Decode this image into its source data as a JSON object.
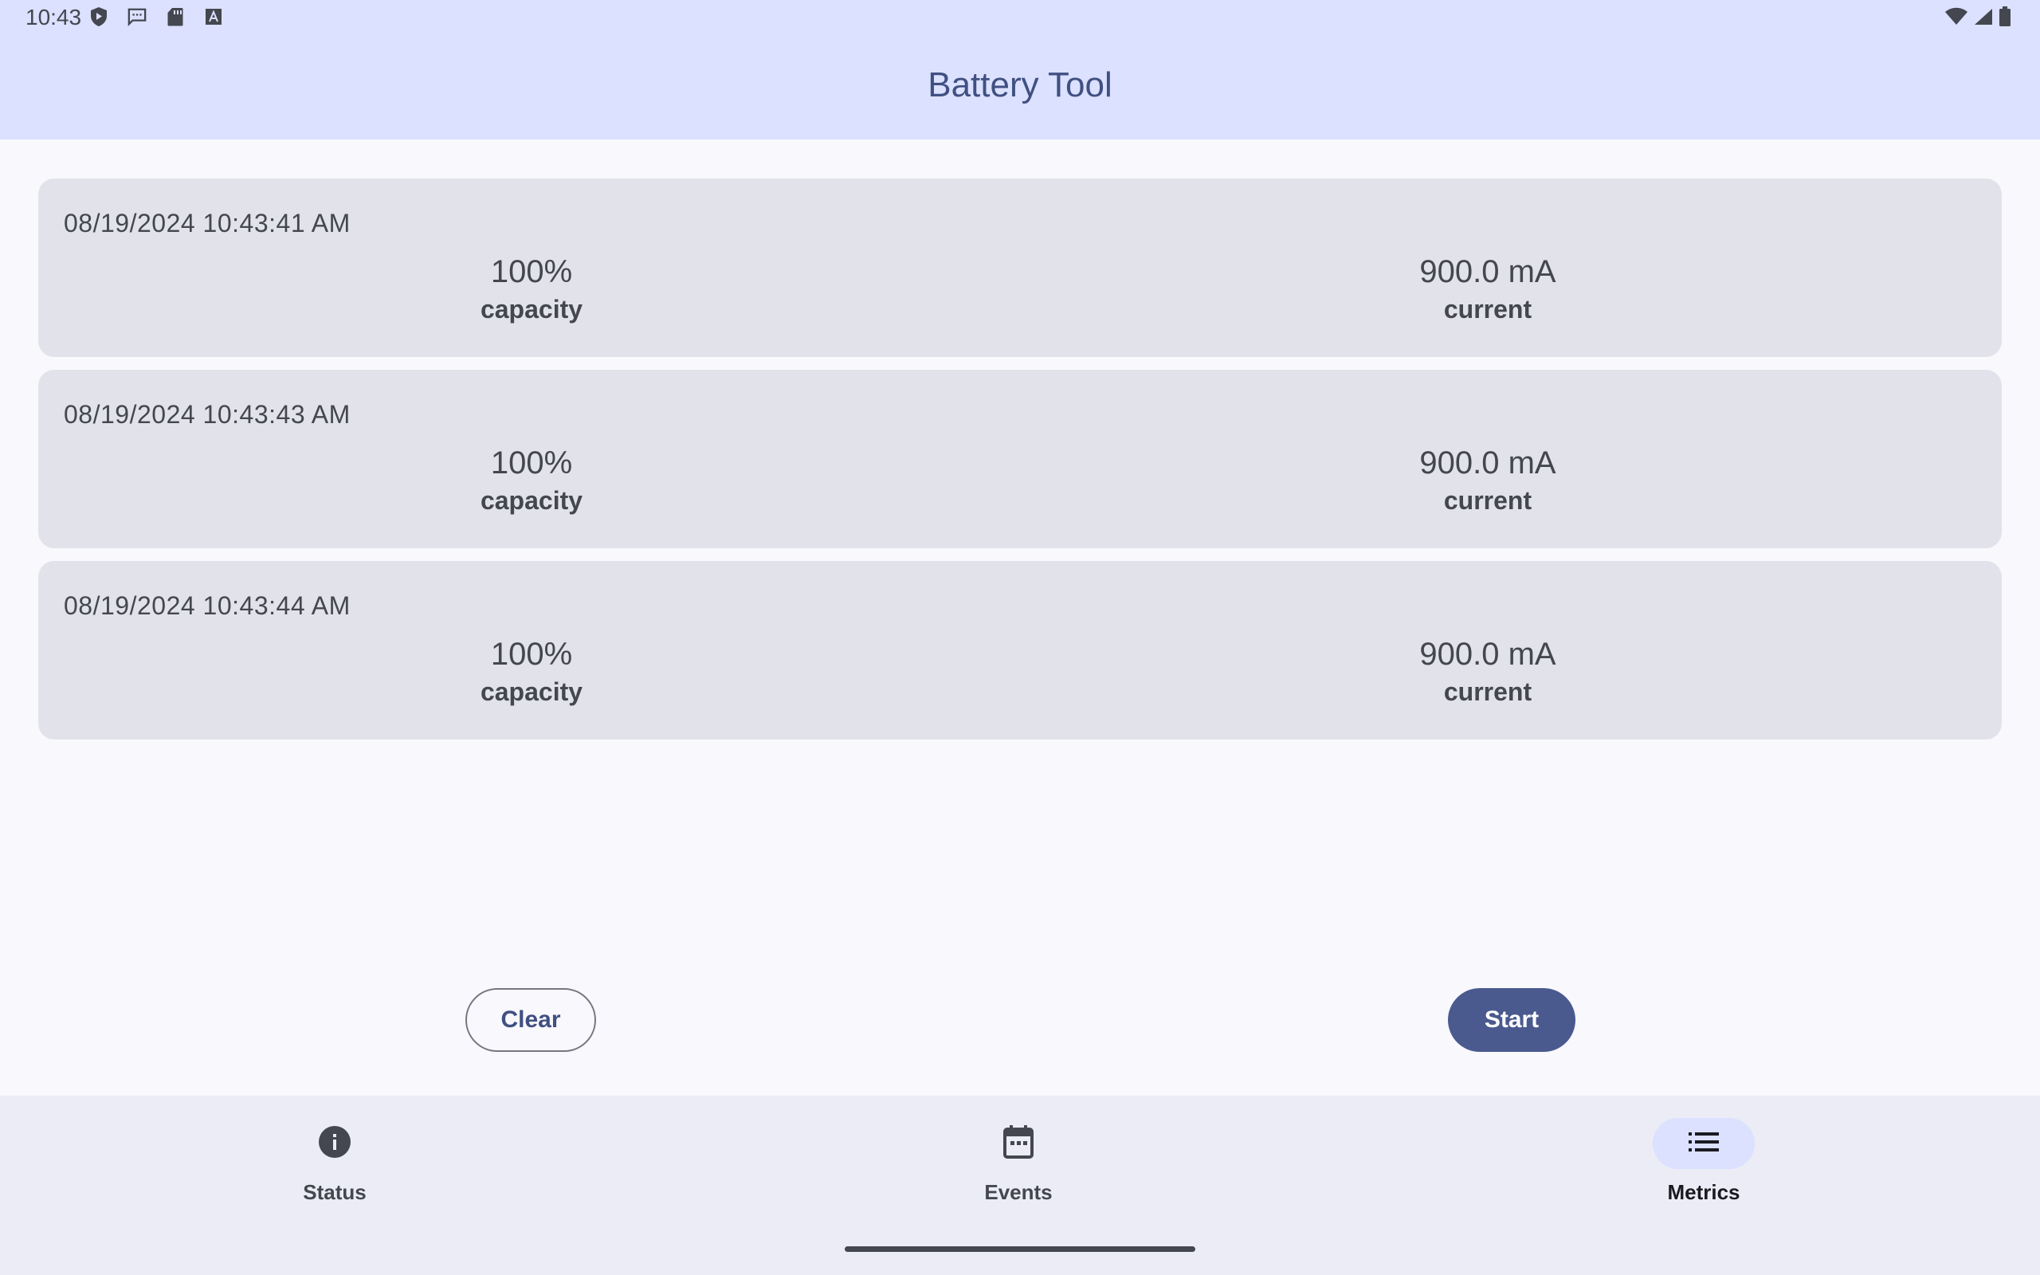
{
  "status_bar": {
    "time": "10:43",
    "left_icons": [
      "play-protect-icon",
      "message-icon",
      "sd-card-icon",
      "text-a-icon"
    ],
    "right_icons": [
      "wifi-icon",
      "signal-icon",
      "battery-icon"
    ]
  },
  "app_bar": {
    "title": "Battery Tool"
  },
  "records": [
    {
      "timestamp": "08/19/2024 10:43:41 AM",
      "capacity_value": "100%",
      "capacity_label": "capacity",
      "current_value": "900.0 mA",
      "current_label": "current"
    },
    {
      "timestamp": "08/19/2024 10:43:43 AM",
      "capacity_value": "100%",
      "capacity_label": "capacity",
      "current_value": "900.0 mA",
      "current_label": "current"
    },
    {
      "timestamp": "08/19/2024 10:43:44 AM",
      "capacity_value": "100%",
      "capacity_label": "capacity",
      "current_value": "900.0 mA",
      "current_label": "current"
    }
  ],
  "actions": {
    "clear_label": "Clear",
    "start_label": "Start"
  },
  "bottom_nav": {
    "items": [
      {
        "label": "Status",
        "icon": "info-icon",
        "active": false
      },
      {
        "label": "Events",
        "icon": "calendar-icon",
        "active": false
      },
      {
        "label": "Metrics",
        "icon": "list-icon",
        "active": true
      }
    ]
  },
  "colors": {
    "app_bar_bg": "#dbe1ff",
    "title_color": "#415082",
    "card_bg": "#e2e2ea",
    "primary": "#4a5a8f",
    "nav_bg": "#ebecf5"
  }
}
